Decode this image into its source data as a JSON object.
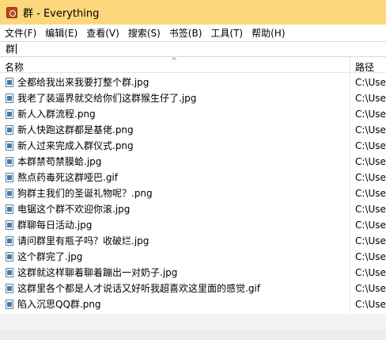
{
  "window": {
    "title": "群 - Everything"
  },
  "menu": [
    "文件(F)",
    "编辑(E)",
    "查看(V)",
    "搜索(S)",
    "书签(B)",
    "工具(T)",
    "帮助(H)"
  ],
  "search": {
    "value": "群"
  },
  "columns": {
    "name": "名称",
    "path": "路径"
  },
  "files": [
    {
      "name": "全都给我出来我要打整个群.jpg",
      "path": "C:\\User"
    },
    {
      "name": "我老了装逼界就交给你们这群猴生仔了.jpg",
      "path": "C:\\User"
    },
    {
      "name": "新人入群流程.png",
      "path": "C:\\User"
    },
    {
      "name": "新人快跑这群都是基佬.png",
      "path": "C:\\User"
    },
    {
      "name": "新人过来完成入群仪式.png",
      "path": "C:\\User"
    },
    {
      "name": "本群禁苟禁膜蛤.jpg",
      "path": "C:\\User"
    },
    {
      "name": "熬点药毒死这群哑巴.gif",
      "path": "C:\\User"
    },
    {
      "name": "狗群主我们的圣诞礼物呢？.png",
      "path": "C:\\User"
    },
    {
      "name": "电锯这个群不欢迎你滚.jpg",
      "path": "C:\\User"
    },
    {
      "name": "群聊每日活动.jpg",
      "path": "C:\\User"
    },
    {
      "name": "请问群里有瓶子吗？收破烂.jpg",
      "path": "C:\\User"
    },
    {
      "name": "这个群完了.jpg",
      "path": "C:\\User"
    },
    {
      "name": "这群就这样聊着聊着蹦出一对奶子.jpg",
      "path": "C:\\User"
    },
    {
      "name": "这群里各个都是人才说话又好听我超喜欢这里面的感觉.gif",
      "path": "C:\\User"
    },
    {
      "name": "陷入沉思QQ群.png",
      "path": "C:\\User"
    }
  ]
}
